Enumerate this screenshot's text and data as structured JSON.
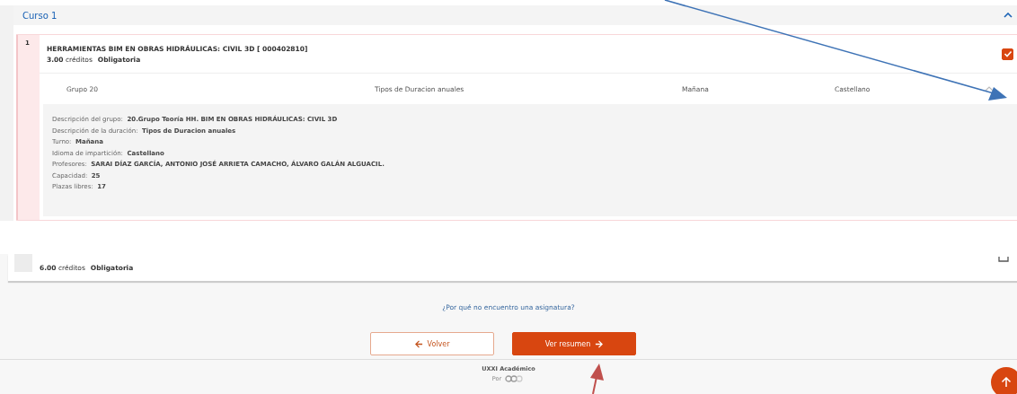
{
  "course": {
    "title": "Curso 1",
    "expanded": true
  },
  "subject": {
    "number": "1",
    "title": "HERRAMIENTAS BIM EN OBRAS HIDRÁULICAS: CIVIL 3D [ 000402810]",
    "credits": "3.00",
    "credits_label": "créditos",
    "type": "Obligatoria",
    "checked": true,
    "group": {
      "name": "Grupo 20",
      "duration": "Tipos de Duracion anuales",
      "shift": "Mañana",
      "language": "Castellano",
      "expanded": true,
      "details": [
        {
          "label": "Descripción del grupo:",
          "value": "20.Grupo Teoría HH. BIM EN OBRAS HIDRÁULICAS: CIVIL 3D"
        },
        {
          "label": "Descripción de la duración:",
          "value": "Tipos de Duracion anuales"
        },
        {
          "label": "Turno:",
          "value": "Mañana"
        },
        {
          "label": "Idioma de impartición:",
          "value": "Castellano"
        },
        {
          "label": "Profesores:",
          "value": "SARAI DÍAZ GARCÍA, ANTONIO JOSÉ ARRIETA CAMACHO, ÁLVARO GALÁN ALGUACIL."
        },
        {
          "label": "Capacidad:",
          "value": "25"
        },
        {
          "label": "Plazas libres:",
          "value": "17"
        }
      ]
    }
  },
  "next_subject": {
    "credits": "6.00",
    "credits_label": "créditos",
    "type": "Obligatoria"
  },
  "help_link": "¿Por qué no encuentro una asignatura?",
  "buttons": {
    "back": "Volver",
    "next": "Ver resumen"
  },
  "footer": {
    "product": "UXXI Académico",
    "by": "Por"
  }
}
